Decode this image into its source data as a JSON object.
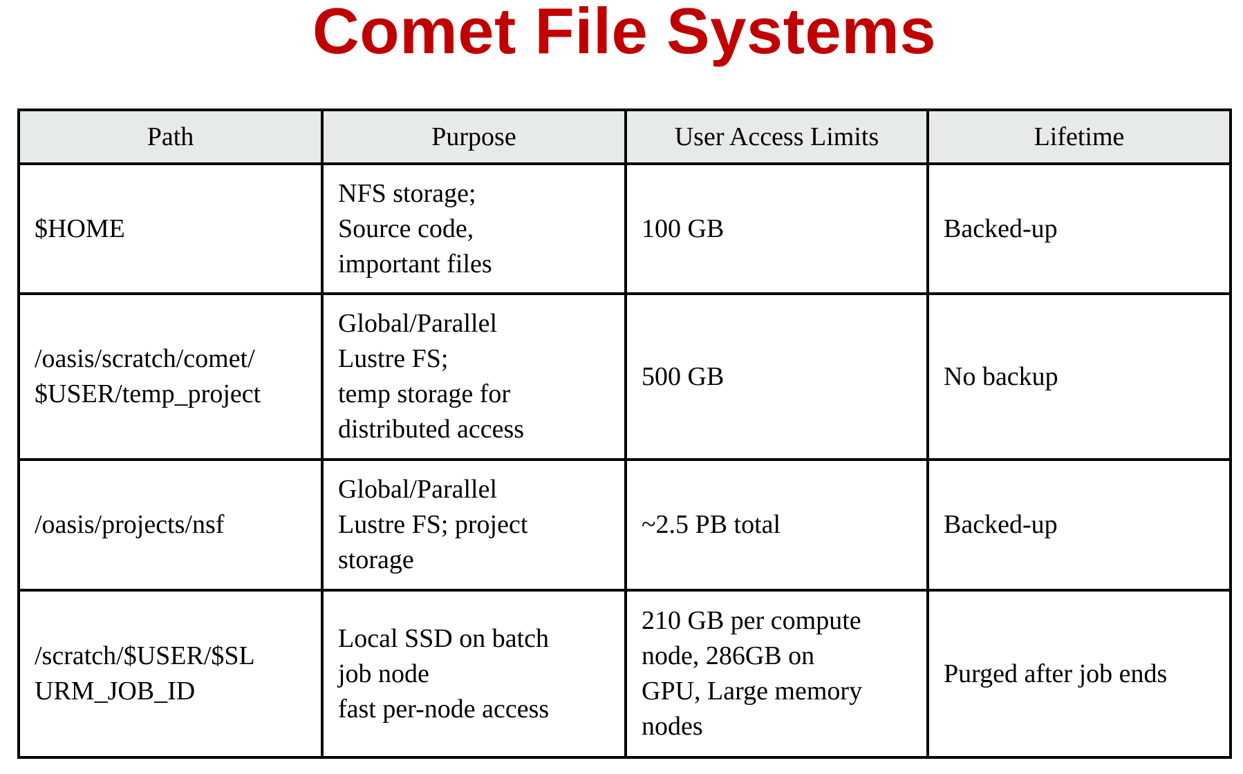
{
  "title": "Comet File Systems",
  "colors": {
    "title": "#C00000",
    "header_bg": "#E6EAEA",
    "border": "#000000"
  },
  "table": {
    "headers": [
      "Path",
      "Purpose",
      "User Access Limits",
      "Lifetime"
    ],
    "rows": [
      {
        "path": [
          "$HOME"
        ],
        "purpose": [
          "NFS storage;",
          "Source code,",
          "important files"
        ],
        "limits": [
          "100 GB"
        ],
        "lifetime": [
          "Backed-up"
        ]
      },
      {
        "path": [
          "/oasis/scratch/comet/",
          "$USER/temp_project"
        ],
        "purpose": [
          "Global/Parallel",
          "Lustre FS;",
          "temp storage for",
          "distributed access"
        ],
        "limits": [
          "500 GB"
        ],
        "lifetime": [
          "No backup"
        ]
      },
      {
        "path": [
          "/oasis/projects/nsf"
        ],
        "purpose": [
          "Global/Parallel",
          "Lustre FS; project",
          "storage"
        ],
        "limits": [
          "~2.5 PB total"
        ],
        "lifetime": [
          "Backed-up"
        ]
      },
      {
        "path": [
          "/scratch/$USER/$SL",
          "URM_JOB_ID"
        ],
        "purpose": [
          "Local SSD on batch",
          "job node",
          "fast per-node access"
        ],
        "limits": [
          "210 GB per compute",
          "node, 286GB on",
          "GPU, Large memory",
          "nodes"
        ],
        "lifetime": [
          "Purged after job ends"
        ]
      }
    ]
  }
}
